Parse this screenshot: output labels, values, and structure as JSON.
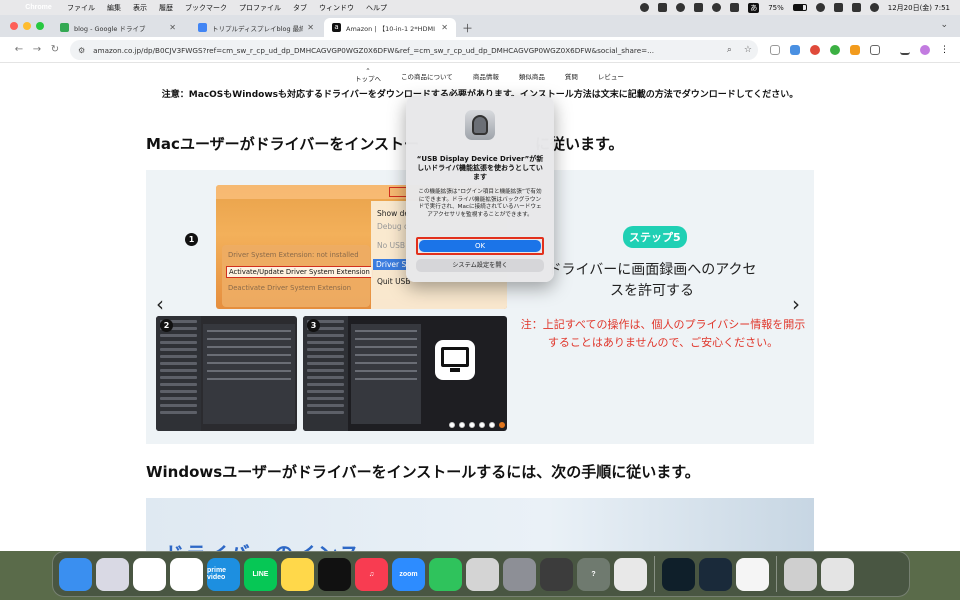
{
  "menubar": {
    "app": "Chrome",
    "items": [
      "ファイル",
      "編集",
      "表示",
      "履歴",
      "ブックマーク",
      "プロファイル",
      "タブ",
      "ウィンドウ",
      "ヘルプ"
    ],
    "battery": "75%",
    "input_source": "あ",
    "clock": "12月20日(金)  7:51"
  },
  "tabs": [
    {
      "title": "blog - Google ドライブ",
      "favicon": "drive-icon",
      "color": "#34a853"
    },
    {
      "title": "トリプルディスプレイblog 最終",
      "favicon": "docs-icon",
      "color": "#4285f4"
    },
    {
      "title": "Amazon | 【10-in-1 2*HDMI ハ",
      "favicon": "amazon-icon",
      "color": "#111111"
    }
  ],
  "omnibox": {
    "url": "amazon.co.jp/dp/B0CJV3FWGS?ref=cm_sw_r_cp_ud_dp_DMHCAGVGP0WGZ0X6DFW&ref_=cm_sw_r_cp_ud_dp_DMHCAGVGP0WGZ0X6DFW&social_share=..."
  },
  "subnav": {
    "top": "トップへ",
    "items": [
      "この商品について",
      "商品情報",
      "類似商品",
      "質問",
      "レビュー"
    ]
  },
  "notice": "注意：MacOSもWindowsも対応するドライバーをダウンロードする必要があります。インストール方法は文末に記載の方法でダウンロードしてください。",
  "heading_mac_part1": "Macユーザーがドライバーをインストー",
  "heading_mac_part2": "に従います。",
  "heading_win": "Windowsユーザーがドライバーをインストールするには、次の手順に従います。",
  "carousel": {
    "step_badge": "ステップ5",
    "step_text": "ドライバーに画面録画へのアクセスを許可する",
    "note": "注：上記すべての操作は、個人のプライバシー情報を開示することはありませんので、ご安心ください。",
    "shot1": {
      "row1": "Driver System Extension: not installed",
      "row2": "Activate/Update Driver System Extension",
      "row3": "Deactivate Driver System Extension",
      "menu": [
        "Show de",
        "Debug o",
        "No USB",
        "Driver S",
        "Quit USB"
      ]
    },
    "labels": [
      "1",
      "2",
      "3"
    ],
    "active_dot": 5,
    "dot_count": 6
  },
  "banner_text": "ドライバーのインス",
  "dialog": {
    "title": "“USB Display Device Driver”が新しいドライバ機能拡張を使おうとしています",
    "body": "この機能拡張は“ログイン項目と機能拡張”で有効にできます。ドライバ機能拡張はバックグラウンドで実行され、Macに接続されているハードウェアアクセサリを監視することができます。",
    "ok": "OK",
    "open_settings": "システム設定を開く"
  },
  "dock": [
    {
      "name": "finder",
      "bg": "#3a8ff0",
      "label": ""
    },
    {
      "name": "launchpad",
      "bg": "#d9d9e4",
      "label": ""
    },
    {
      "name": "chrome",
      "bg": "#ffffff",
      "label": ""
    },
    {
      "name": "photos",
      "bg": "#ffffff",
      "label": ""
    },
    {
      "name": "prime-video",
      "bg": "#1d8fe0",
      "label": "prime video"
    },
    {
      "name": "line",
      "bg": "#06c755",
      "label": "LINE"
    },
    {
      "name": "notes",
      "bg": "#ffd84a",
      "label": ""
    },
    {
      "name": "clock",
      "bg": "#111111",
      "label": ""
    },
    {
      "name": "music",
      "bg": "#f83c51",
      "label": "♫"
    },
    {
      "name": "zoom",
      "bg": "#2d8cff",
      "label": "zoom"
    },
    {
      "name": "facetime",
      "bg": "#2fc35c",
      "label": ""
    },
    {
      "name": "mouse-utility",
      "bg": "#d4d4d4",
      "label": ""
    },
    {
      "name": "system-settings",
      "bg": "#8d8f96",
      "label": ""
    },
    {
      "name": "calculator",
      "bg": "#3c3c3c",
      "label": ""
    },
    {
      "name": "unknown-app",
      "bg": "#6f7a6f",
      "label": "?"
    },
    {
      "name": "iphone-mirroring",
      "bg": "#e8e8e8",
      "label": ""
    },
    {
      "name": "filmora",
      "bg": "#0f1f2a",
      "label": ""
    },
    {
      "name": "quicktime",
      "bg": "#1a2a3a",
      "label": ""
    },
    {
      "name": "1password",
      "bg": "#f5f5f5",
      "label": ""
    },
    {
      "name": "display-driver",
      "bg": "#cfcfcf",
      "label": ""
    },
    {
      "name": "trash",
      "bg": "#e4e4e4",
      "label": ""
    }
  ]
}
